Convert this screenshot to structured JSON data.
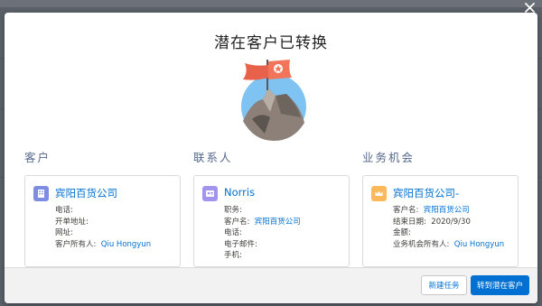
{
  "modal": {
    "title": "潜在客户已转换"
  },
  "columns": [
    {
      "heading": "客户",
      "icon": "account-icon",
      "icon_color": "#7f8de1",
      "name": "宾阳百货公司",
      "fields": [
        {
          "label": "电话:",
          "value": ""
        },
        {
          "label": "开单地址:",
          "value": ""
        },
        {
          "label": "网址:",
          "value": ""
        },
        {
          "label": "客户所有人:",
          "value": "Qiu Hongyun"
        }
      ]
    },
    {
      "heading": "联系人",
      "icon": "contact-icon",
      "icon_color": "#a094ed",
      "name": "Norris",
      "fields": [
        {
          "label": "职务:",
          "value": ""
        },
        {
          "label": "客户名:",
          "value": "宾阳百货公司"
        },
        {
          "label": "电话:",
          "value": ""
        },
        {
          "label": "电子邮件:",
          "value": ""
        },
        {
          "label": "手机:",
          "value": ""
        }
      ]
    },
    {
      "heading": "业务机会",
      "icon": "opportunity-crown-icon",
      "icon_color": "#fcb95b",
      "name": "宾阳百货公司-",
      "fields": [
        {
          "label": "客户名:",
          "value": "宾阳百货公司"
        },
        {
          "label": "结束日期:",
          "value": "2020/9/30"
        },
        {
          "label": "金额:",
          "value": ""
        },
        {
          "label": "业务机会所有人:",
          "value": "Qiu Hongyun"
        }
      ]
    }
  ],
  "footer": {
    "new_task_label": "新建任务",
    "go_to_leads_label": "转到潜在客户"
  },
  "colors": {
    "brand": "#0070d2",
    "flag": "#f0755a"
  }
}
